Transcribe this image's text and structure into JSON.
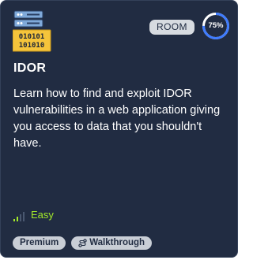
{
  "card": {
    "icon": "server-binary-icon",
    "badge": "ROOM",
    "progress": {
      "percent": 75,
      "label": "75%"
    },
    "title": "IDOR",
    "description": "Learn how to find and exploit IDOR vulnerabilities in a web application giving you access to data that you shouldn't have.",
    "difficulty": {
      "label": "Easy",
      "icon": "signal-bars-icon",
      "color": "#a3ea2a"
    },
    "tags": [
      {
        "label": "Premium"
      },
      {
        "label": "Walkthrough",
        "icon": "route-icon"
      }
    ]
  },
  "colors": {
    "card_background": "#212c42",
    "progress_track": "#ffffff",
    "progress_fill": "#3f7cff",
    "easy": "#a3ea2a"
  }
}
